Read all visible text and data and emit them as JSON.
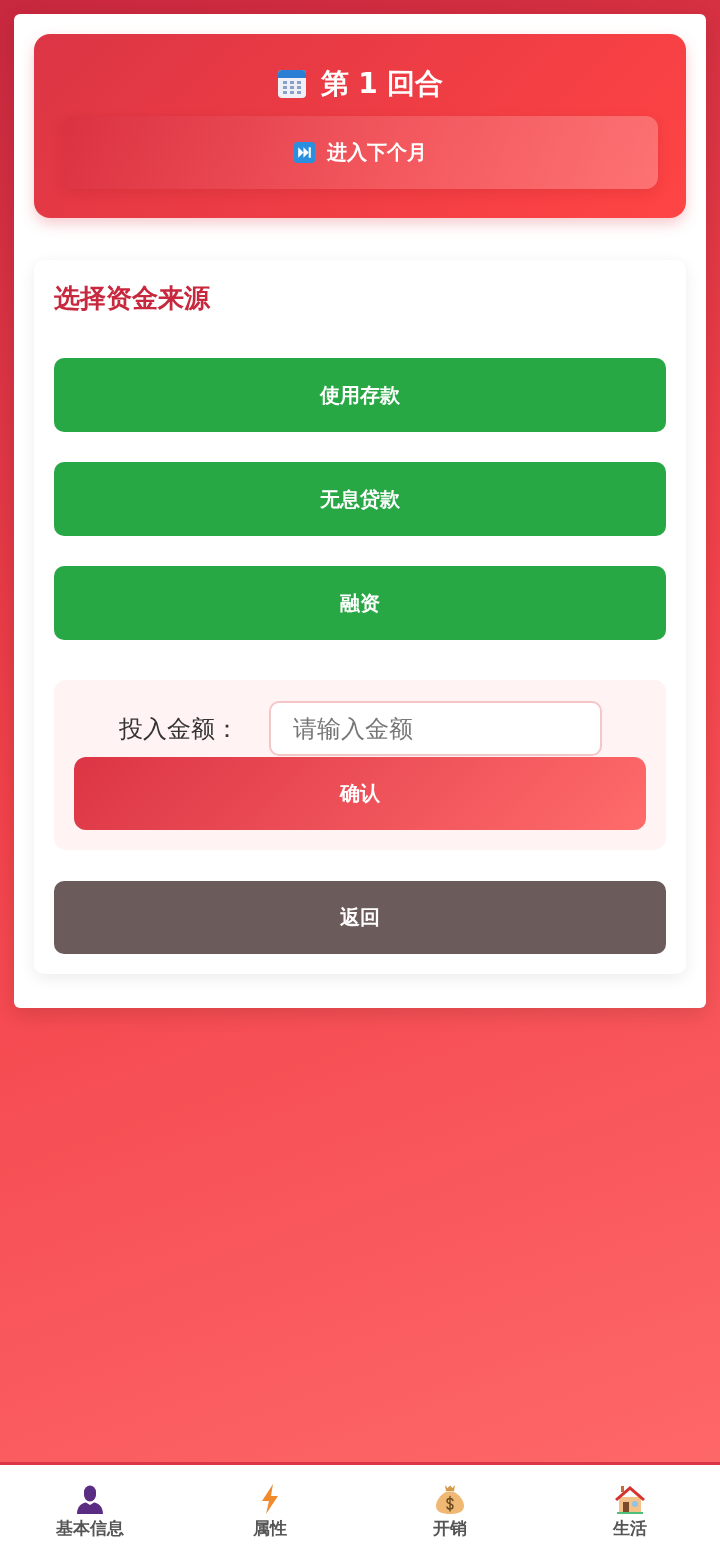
{
  "round": {
    "title": "第 1 回合",
    "next_button": "进入下个月"
  },
  "funding": {
    "title": "选择资金来源",
    "options": [
      "使用存款",
      "无息贷款",
      "融资"
    ],
    "amount": {
      "label": "投入金额：",
      "placeholder": "请输入金额"
    },
    "confirm_button": "确认",
    "back_button": "返回"
  },
  "bottom_nav": [
    {
      "label": "基本信息"
    },
    {
      "label": "属性"
    },
    {
      "label": "开销"
    },
    {
      "label": "生活"
    }
  ]
}
